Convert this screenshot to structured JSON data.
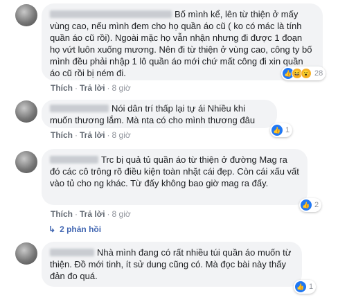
{
  "comments": [
    {
      "text": "Bố mình kể, lên từ thiện ở mấy vùng cao, nếu mình đem cho họ quần áo cũ ( ko có mác là tính quần áo cũ rồi). Ngoài mặc họ vẫn nhận nhưng đi được 1 đoạn họ vứt luôn xuống mương. Nên đi từ thiện ở vùng cao, công ty bố mình đều phải nhập 1 lô quần áo mới chứ mất công đi xin quần áo cũ rồi bị ném đi.",
      "actions": {
        "like": "Thích",
        "reply": "Trả lời",
        "time": "8 giờ"
      },
      "reaction_count": "28"
    },
    {
      "text": "Nói dân trí thấp lại tự ái Nhiều khi muốn thương lắm. Mà nta có cho mình thương đâu",
      "actions": {
        "like": "Thích",
        "reply": "Trả lời",
        "time": "8 giờ"
      },
      "reaction_count": "1"
    },
    {
      "text": "Trc bị quả tủ quần áo từ thiện ở đường Mag ra đó các cô trông rõ điều kiện toàn nhặt cái đẹp. Còn cái xấu vất vào tủ cho ng khác. Từ đấy không bao giờ mag ra đấy.",
      "actions": {
        "like": "Thích",
        "reply": "Trả lời",
        "time": "8 giờ"
      },
      "reaction_count": "2",
      "replies_label": "2 phản hồi"
    },
    {
      "text": "Nhà mình đang có rất nhiều túi quần áo muốn từ thiện. Đồ mới tinh, ít sử dung cũng có. Mà đọc bài này thấy đản đo quá.",
      "reaction_count": "1"
    }
  ],
  "colors": {
    "like": "#2078f4",
    "haha": "#f7b125",
    "link": "#4267b2",
    "bubble": "#f2f3f5"
  }
}
